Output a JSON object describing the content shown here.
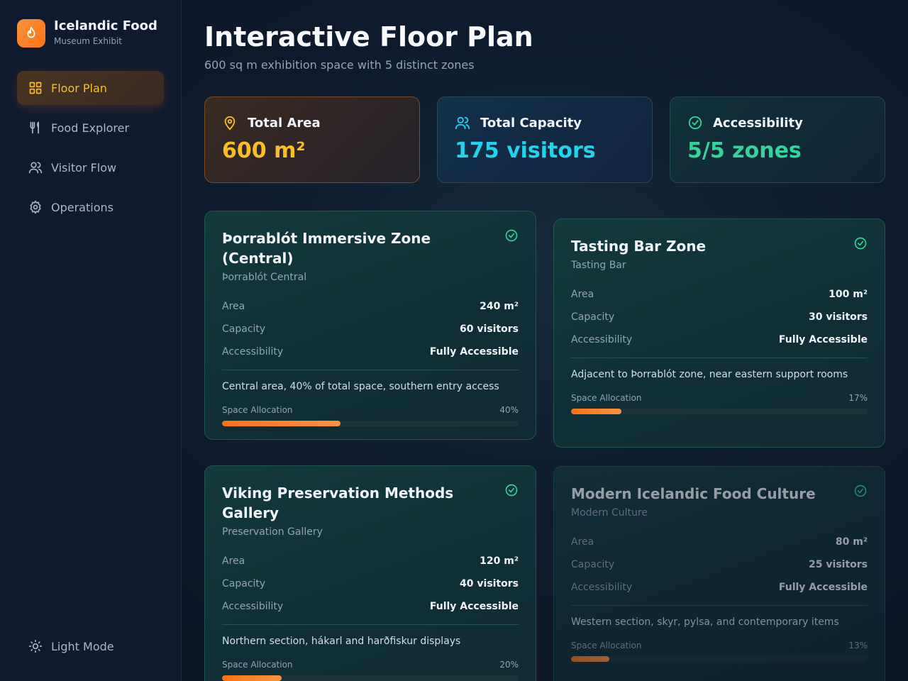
{
  "brand": {
    "title": "Icelandic Food",
    "subtitle": "Museum Exhibit",
    "icon": "flame-icon",
    "accent": "#f97316"
  },
  "nav": [
    {
      "label": "Floor Plan",
      "icon": "grid-icon",
      "active": true
    },
    {
      "label": "Food Explorer",
      "icon": "utensils-icon",
      "active": false
    },
    {
      "label": "Visitor Flow",
      "icon": "users-icon",
      "active": false
    },
    {
      "label": "Operations",
      "icon": "gear-icon",
      "active": false
    }
  ],
  "light_mode_label": "Light Mode",
  "page": {
    "title": "Interactive Floor Plan",
    "subtitle": "600 sq m exhibition space with 5 distinct zones"
  },
  "stats": {
    "area": {
      "label": "Total Area",
      "value": "600 m²",
      "color": "#fbbf24"
    },
    "capacity": {
      "label": "Total Capacity",
      "value": "175 visitors",
      "color": "#22d3ee"
    },
    "accessibility": {
      "label": "Accessibility",
      "value": "5/5 zones",
      "color": "#34d399"
    }
  },
  "zones": [
    {
      "title": "Þorrablót Immersive Zone (Central)",
      "subtitle": "Þorrablót Central",
      "area_label": "Area",
      "area": "240 m²",
      "capacity_label": "Capacity",
      "capacity": "60 visitors",
      "access_label": "Accessibility",
      "access": "Fully Accessible",
      "description": "Central area, 40% of total space, southern entry access",
      "alloc_label": "Space Allocation",
      "alloc_text": "40%",
      "alloc": 0.4
    },
    {
      "title": "Tasting Bar Zone",
      "subtitle": "Tasting Bar",
      "area_label": "Area",
      "area": "100 m²",
      "capacity_label": "Capacity",
      "capacity": "30 visitors",
      "access_label": "Accessibility",
      "access": "Fully Accessible",
      "description": "Adjacent to Þorrablót zone, near eastern support rooms",
      "alloc_label": "Space Allocation",
      "alloc_text": "17%",
      "alloc": 0.17
    },
    {
      "title": "Viking Preservation Methods Gallery",
      "subtitle": "Preservation Gallery",
      "area_label": "Area",
      "area": "120 m²",
      "capacity_label": "Capacity",
      "capacity": "40 visitors",
      "access_label": "Accessibility",
      "access": "Fully Accessible",
      "description": "Northern section, hákarl and harðfiskur displays",
      "alloc_label": "Space Allocation",
      "alloc_text": "20%",
      "alloc": 0.2
    },
    {
      "title": "Modern Icelandic Food Culture",
      "subtitle": "Modern Culture",
      "area_label": "Area",
      "area": "80 m²",
      "capacity_label": "Capacity",
      "capacity": "25 visitors",
      "access_label": "Accessibility",
      "access": "Fully Accessible",
      "description": "Western section, skyr, pylsa, and contemporary items",
      "alloc_label": "Space Allocation",
      "alloc_text": "13%",
      "alloc": 0.13
    }
  ]
}
